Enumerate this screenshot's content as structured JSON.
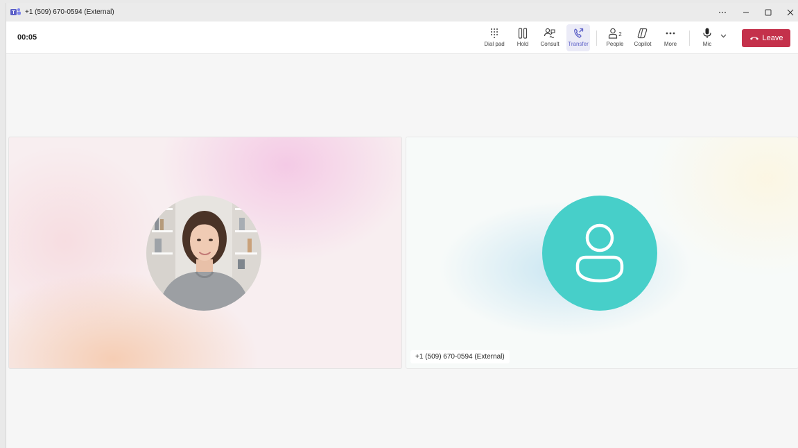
{
  "window": {
    "title": "+1 (509) 670-0594 (External)"
  },
  "toolbar": {
    "timer": "00:05",
    "buttons": [
      {
        "id": "dialpad",
        "label": "Dial pad",
        "icon": "dialpad-icon"
      },
      {
        "id": "hold",
        "label": "Hold",
        "icon": "pause-icon"
      },
      {
        "id": "consult",
        "label": "Consult",
        "icon": "consult-icon"
      },
      {
        "id": "transfer",
        "label": "Transfer",
        "icon": "transfer-icon",
        "active": true
      },
      {
        "id": "people",
        "label": "People",
        "icon": "person-icon",
        "count": "2"
      },
      {
        "id": "copilot",
        "label": "Copilot",
        "icon": "copilot-icon"
      },
      {
        "id": "more",
        "label": "More",
        "icon": "more-icon"
      },
      {
        "id": "mic",
        "label": "Mic",
        "icon": "mic-icon"
      }
    ],
    "leave_label": "Leave"
  },
  "stage": {
    "participants": [
      {
        "avatar": "photo"
      },
      {
        "avatar": "generic-person-icon",
        "name": "+1 (509) 670-0594 (External)",
        "color": "#47cfc9"
      }
    ]
  },
  "colors": {
    "leave": "#c4314b",
    "active_accent": "#5b5fc7",
    "avatar_teal": "#47cfc9"
  }
}
